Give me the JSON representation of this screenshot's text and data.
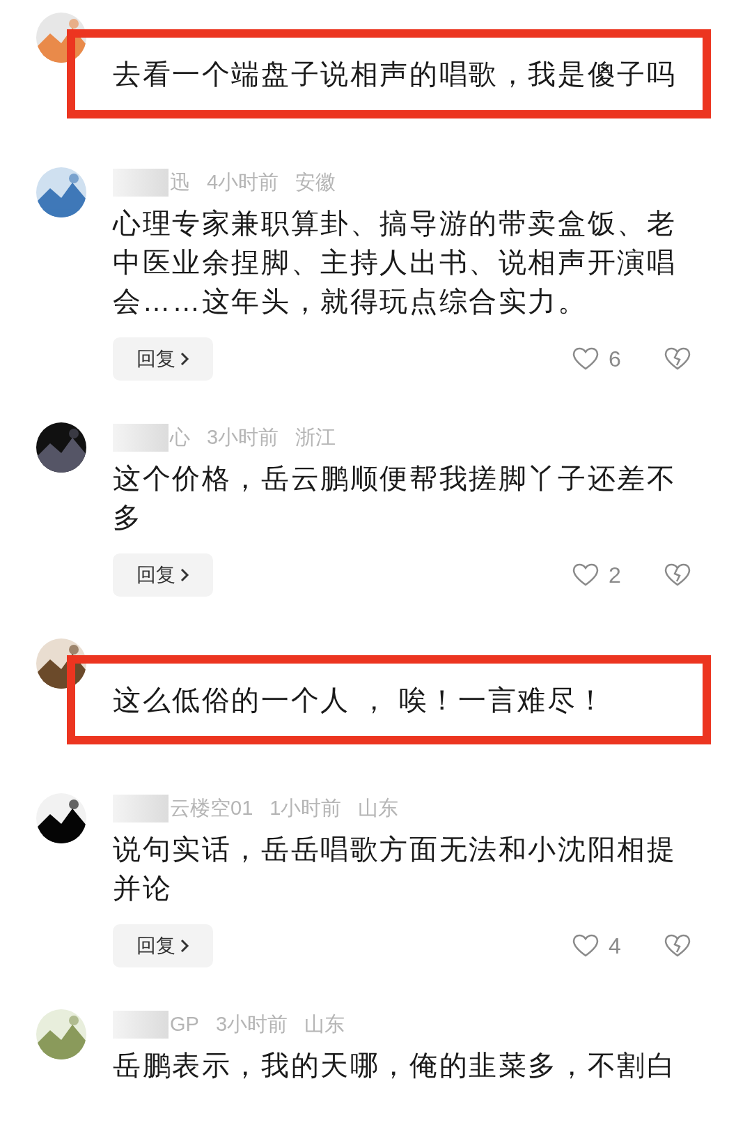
{
  "comments": [
    {
      "text": "去看一个端盘子说相声的唱歌，我是傻子吗",
      "highlighted": true
    },
    {
      "author": "迅",
      "time": "4小时前",
      "region": "安徽",
      "text": "心理专家兼职算卦、搞导游的带卖盒饭、老中医业余捏脚、主持人出书、说相声开演唱会……这年头，就得玩点综合实力。",
      "highlighted": false,
      "reply": "回复",
      "likes": "6"
    },
    {
      "author": "心",
      "time": "3小时前",
      "region": "浙江",
      "text": "这个价格，岳云鹏顺便帮我搓脚丫子还差不多",
      "highlighted": false,
      "reply": "回复",
      "likes": "2"
    },
    {
      "text": "这么低俗的一个人 ， 唉！一言难尽！",
      "highlighted": true
    },
    {
      "author": "云楼空01",
      "time": "1小时前",
      "region": "山东",
      "text": "说句实话，岳岳唱歌方面无法和小沈阳相提并论",
      "highlighted": false,
      "reply": "回复",
      "likes": "4"
    },
    {
      "author": "GP",
      "time": "3小时前",
      "region": "山东",
      "text": "岳鹏表示，我的天哪，俺的韭菜多，不割白",
      "highlighted": false
    }
  ]
}
